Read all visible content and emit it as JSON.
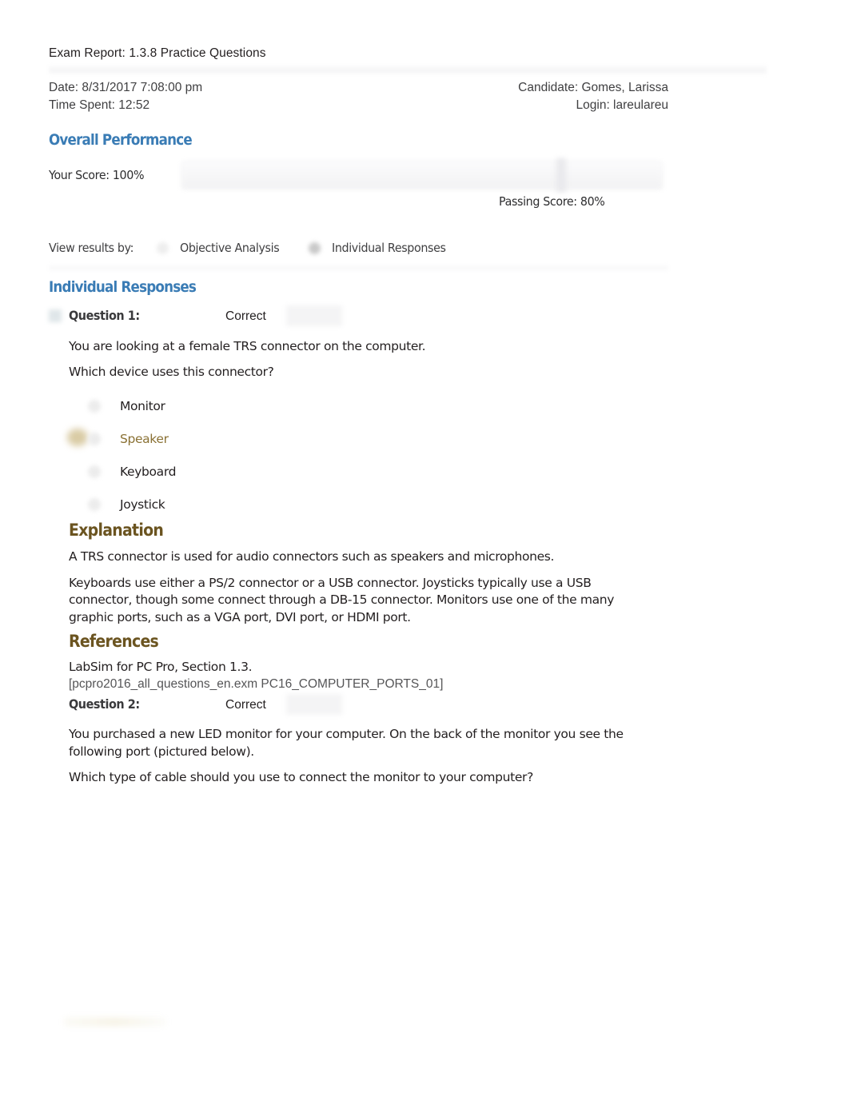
{
  "document": {
    "title": "Exam Report: 1.3.8 Practice Questions"
  },
  "meta": {
    "date": "Date: 8/31/2017 7:08:00 pm",
    "time_spent": "Time Spent: 12:52",
    "candidate": "Candidate: Gomes, Larissa",
    "login": "Login: lareulareu"
  },
  "overall_performance": {
    "heading": "Overall Performance",
    "your_score": "Your Score: 100%",
    "passing_score": "Passing Score: 80%",
    "score_value": 100,
    "passing_value": 80
  },
  "view_results": {
    "label": "View results by:",
    "options": [
      {
        "label": "Objective Analysis",
        "selected": false
      },
      {
        "label": "Individual Responses",
        "selected": true
      }
    ]
  },
  "individual_responses": {
    "heading": "Individual Responses"
  },
  "questions": [
    {
      "label": "Question 1:",
      "status": "Correct",
      "prompt_lines": [
        "You are looking at a female TRS connector on the computer.",
        "Which device uses this connector?"
      ],
      "answers": [
        {
          "text": "Monitor",
          "correct": false
        },
        {
          "text": "Speaker",
          "correct": true
        },
        {
          "text": "Keyboard",
          "correct": false
        },
        {
          "text": "Joystick",
          "correct": false
        }
      ],
      "explanation": {
        "heading": "Explanation",
        "paragraphs": [
          "A TRS connector is used for audio connectors such as speakers and microphones.",
          "Keyboards use either a PS/2 connector or a USB connector. Joysticks typically use a USB connector, though some connect through a DB-15 connector. Monitors use one of the many graphic ports, such as a VGA port, DVI port, or HDMI port."
        ]
      },
      "references": {
        "heading": "References",
        "source": "LabSim for PC Pro, Section 1.3.",
        "identifier": "[pcpro2016_all_questions_en.exm PC16_COMPUTER_PORTS_01]"
      }
    },
    {
      "label": "Question 2:",
      "status": "Correct",
      "prompt_lines": [
        "You purchased a new LED monitor for your computer. On the back of the monitor you see the following port (pictured below).",
        "Which type of cable should you use to connect the monitor to your computer?"
      ]
    }
  ],
  "colors": {
    "heading_blue": "#3a7cb5",
    "subheading_brown": "#6b5420",
    "correct_answer": "#8a7134",
    "body_text": "#231f20",
    "muted_text": "#555557"
  }
}
